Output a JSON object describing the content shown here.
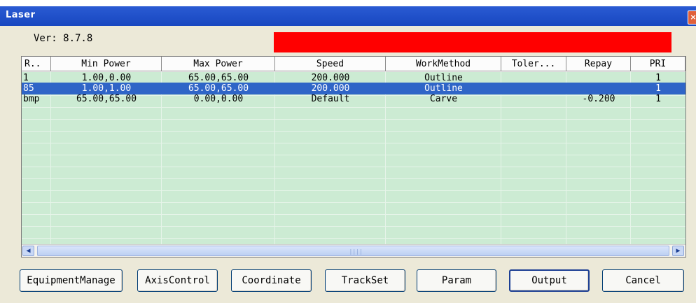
{
  "window": {
    "title": "Laser",
    "close_icon": "close-icon"
  },
  "version_label": "Ver: 8.7.8",
  "status_color": "#ff0000",
  "table": {
    "columns": [
      "R..",
      "Min Power",
      "Max Power",
      "Speed",
      "WorkMethod",
      "Toler...",
      "Repay",
      "PRI"
    ],
    "rows": [
      [
        "1",
        "1.00,0.00",
        "65.00,65.00",
        "200.000",
        "Outline",
        "",
        "",
        "1"
      ],
      [
        "85",
        "1.00,1.00",
        "65.00,65.00",
        "200.000",
        "Outline",
        "",
        "",
        "1"
      ],
      [
        "bmp",
        "65.00,65.00",
        "0.00,0.00",
        "Default",
        "Carve",
        "",
        "-0.200",
        "1"
      ]
    ],
    "selected_row": 1,
    "selection_color": "#2f65c7",
    "grid_color": "#ccebd3"
  },
  "buttons": {
    "equipment_manage": "EquipmentManage",
    "axis_control": "AxisControl",
    "coordinate": "Coordinate",
    "track_set": "TrackSet",
    "param": "Param",
    "output": "Output",
    "cancel": "Cancel"
  }
}
